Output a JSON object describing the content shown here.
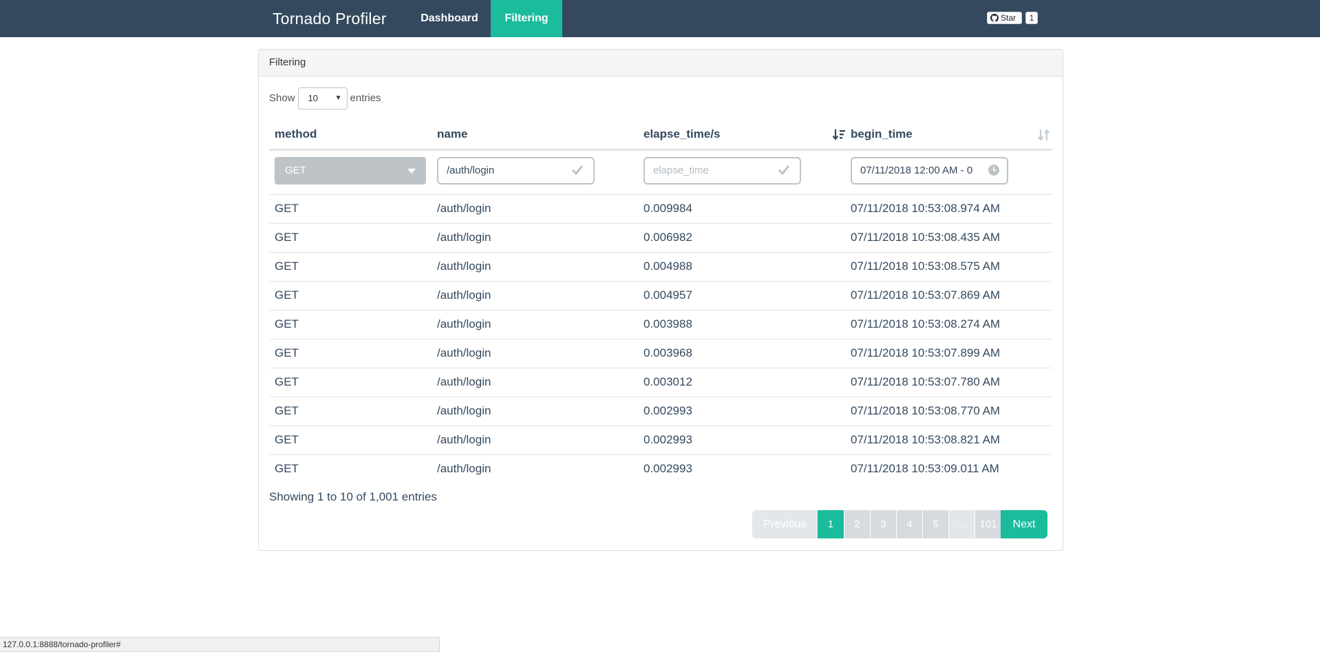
{
  "navbar": {
    "brand": "Tornado Profiler",
    "links": [
      {
        "label": "Dashboard",
        "active": false
      },
      {
        "label": "Filtering",
        "active": true
      }
    ],
    "github": {
      "star_label": "Star",
      "count": "1"
    }
  },
  "panel": {
    "title": "Filtering",
    "length": {
      "prefix": "Show",
      "value": "10",
      "suffix": "entries"
    },
    "columns": [
      "method",
      "name",
      "elapse_time/s",
      "begin_time"
    ],
    "filters": {
      "method": "GET",
      "name": "/auth/login",
      "elapse_placeholder": "elapse_time",
      "begin_time": "07/11/2018 12:00 AM - 0"
    },
    "rows": [
      {
        "method": "GET",
        "name": "/auth/login",
        "elapse": "0.009984",
        "begin": "07/11/2018 10:53:08.974 AM"
      },
      {
        "method": "GET",
        "name": "/auth/login",
        "elapse": "0.006982",
        "begin": "07/11/2018 10:53:08.435 AM"
      },
      {
        "method": "GET",
        "name": "/auth/login",
        "elapse": "0.004988",
        "begin": "07/11/2018 10:53:08.575 AM"
      },
      {
        "method": "GET",
        "name": "/auth/login",
        "elapse": "0.004957",
        "begin": "07/11/2018 10:53:07.869 AM"
      },
      {
        "method": "GET",
        "name": "/auth/login",
        "elapse": "0.003988",
        "begin": "07/11/2018 10:53:08.274 AM"
      },
      {
        "method": "GET",
        "name": "/auth/login",
        "elapse": "0.003968",
        "begin": "07/11/2018 10:53:07.899 AM"
      },
      {
        "method": "GET",
        "name": "/auth/login",
        "elapse": "0.003012",
        "begin": "07/11/2018 10:53:07.780 AM"
      },
      {
        "method": "GET",
        "name": "/auth/login",
        "elapse": "0.002993",
        "begin": "07/11/2018 10:53:08.770 AM"
      },
      {
        "method": "GET",
        "name": "/auth/login",
        "elapse": "0.002993",
        "begin": "07/11/2018 10:53:08.821 AM"
      },
      {
        "method": "GET",
        "name": "/auth/login",
        "elapse": "0.002993",
        "begin": "07/11/2018 10:53:09.011 AM"
      }
    ],
    "info": "Showing 1 to 10 of 1,001 entries",
    "pagination": {
      "previous": "Previous",
      "pages": [
        "1",
        "2",
        "3",
        "4",
        "5",
        "…",
        "101"
      ],
      "active": "1",
      "next": "Next"
    }
  },
  "statusbar": {
    "url": "127.0.0.1:8888/tornado-profiler#"
  },
  "colors": {
    "navbar": "#34495e",
    "accent": "#1abc9c",
    "muted": "#bdc3c7"
  }
}
